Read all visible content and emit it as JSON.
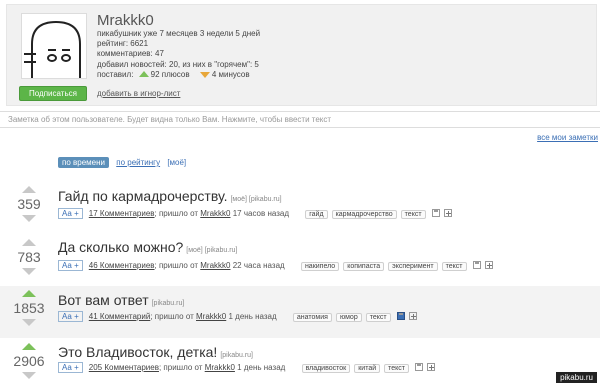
{
  "profile": {
    "username": "Mrakkk0",
    "subscribe_label": "Подписаться",
    "ignore_label": "добавить в игнор-лист",
    "stats": {
      "line1": "пикабушник уже 7 месяцев 3 недели 5 дней",
      "line2": "рейтинг: 6621",
      "line3": "комментариев: 47",
      "line4": "добавил новостей: 20, из них в \"горячем\": 5",
      "line5_prefix": "поставил:",
      "pluses": "92 плюсов",
      "minuses": "4 минусов"
    }
  },
  "note": {
    "text": "Заметка об этом пользователе. Будет видна только Вам. Нажмите, чтобы ввести текст",
    "all_notes_label": "все мои заметки"
  },
  "sort": {
    "by_time": "по времени",
    "by_rating": "по рейтингу",
    "mine": "[моё]"
  },
  "posts": [
    {
      "rating": "359",
      "title": "Гайд по кармадрочерству.",
      "source_tags": "[моё] [pikabu.ru]",
      "aa": "Аа +",
      "comments": "17 Комментариев",
      "from_text": "; пришло от",
      "author": "Mrakkk0",
      "time": "17 часов назад",
      "tags": [
        "гайд",
        "кармадрочерство",
        "текст"
      ]
    },
    {
      "rating": "783",
      "title": "Да сколько можно?",
      "source_tags": "[моё] [pikabu.ru]",
      "aa": "Аа +",
      "comments": "46 Комментариев",
      "from_text": "; пришло от",
      "author": "Mrakkk0",
      "time": "22 часа назад",
      "tags": [
        "накипело",
        "копипаста",
        "эксперимент",
        "текст"
      ]
    },
    {
      "rating": "1853",
      "title": "Вот вам ответ",
      "source_tags": "[pikabu.ru]",
      "aa": "Аа +",
      "comments": "41 Комментарий",
      "from_text": "; пришло от",
      "author": "Mrakkk0",
      "time": "1 день назад",
      "tags": [
        "анатомия",
        "юмор",
        "текст"
      ]
    },
    {
      "rating": "2906",
      "title": "Это Владивосток, детка!",
      "source_tags": "[pikabu.ru]",
      "aa": "Аа +",
      "comments": "205 Комментариев",
      "from_text": "; пришло от",
      "author": "Mrakkk0",
      "time": "1 день назад",
      "tags": [
        "владивосток",
        "китай",
        "текст"
      ]
    }
  ],
  "watermark": "pikabu.ru",
  "colors": {
    "subscribe_green": "#5cb548",
    "plus_green": "#7cc15a",
    "minus_orange": "#e8a73a",
    "link_blue": "#3b6fb5",
    "active_tab": "#5b8fb9"
  }
}
